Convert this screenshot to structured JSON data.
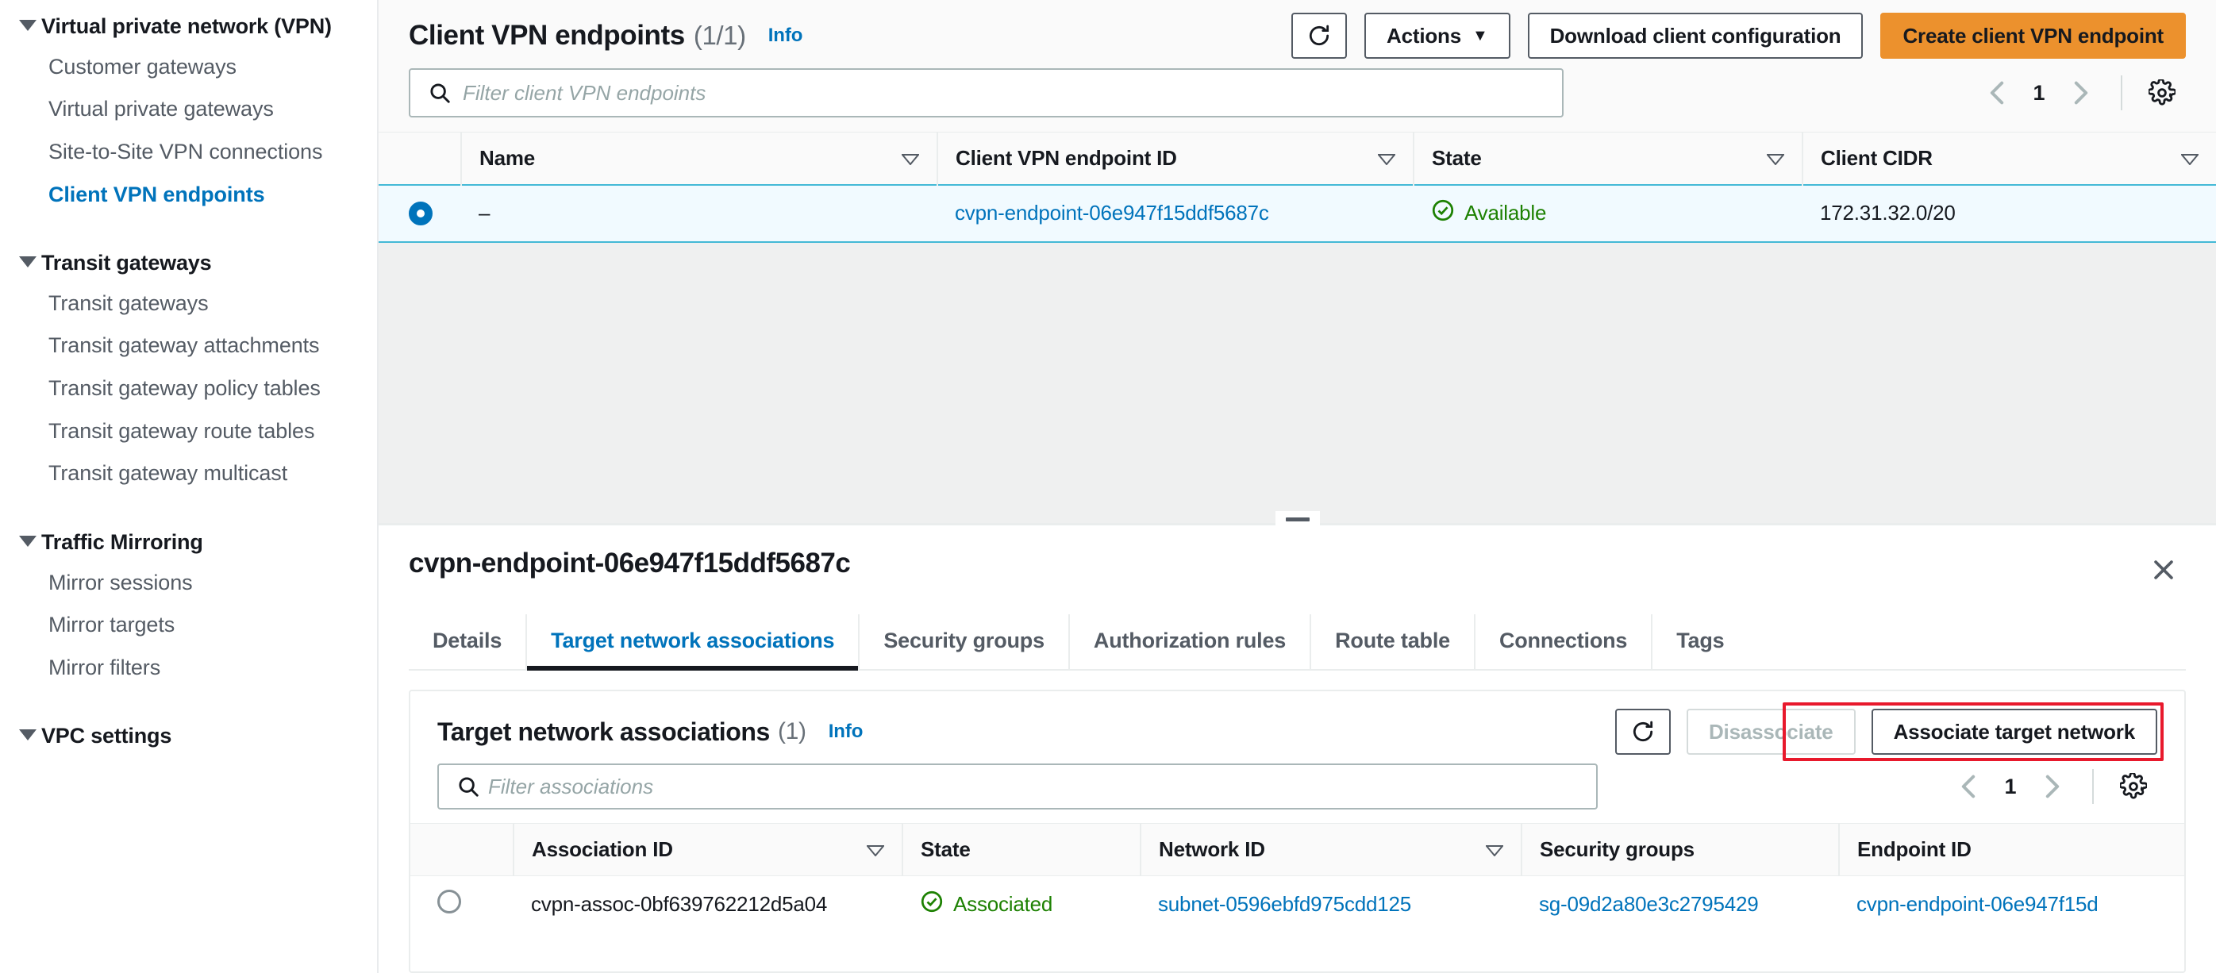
{
  "sidebar": {
    "groups": [
      {
        "title": "Virtual private network (VPN)",
        "icon": "caret-down-icon",
        "items": [
          {
            "label": "Customer gateways",
            "active": false
          },
          {
            "label": "Virtual private gateways",
            "active": false
          },
          {
            "label": "Site-to-Site VPN connections",
            "active": false
          },
          {
            "label": "Client VPN endpoints",
            "active": true
          }
        ]
      },
      {
        "title": "Transit gateways",
        "icon": "caret-down-icon",
        "items": [
          {
            "label": "Transit gateways",
            "active": false
          },
          {
            "label": "Transit gateway attachments",
            "active": false
          },
          {
            "label": "Transit gateway policy tables",
            "active": false
          },
          {
            "label": "Transit gateway route tables",
            "active": false
          },
          {
            "label": "Transit gateway multicast",
            "active": false
          }
        ]
      },
      {
        "title": "Traffic Mirroring",
        "icon": "caret-down-icon",
        "items": [
          {
            "label": "Mirror sessions",
            "active": false
          },
          {
            "label": "Mirror targets",
            "active": false
          },
          {
            "label": "Mirror filters",
            "active": false
          }
        ]
      },
      {
        "title": "VPC settings",
        "icon": "caret-down-icon",
        "items": []
      }
    ]
  },
  "page": {
    "title": "Client VPN endpoints",
    "count": "(1/1)",
    "info_label": "Info",
    "refresh_icon": "refresh-icon",
    "actions_label": "Actions",
    "actions_caret": "chevron-down-icon",
    "download_label": "Download client configuration",
    "create_label": "Create client VPN endpoint",
    "search_placeholder": "Filter client VPN endpoints",
    "search_value": "",
    "search_icon": "search-icon",
    "pagination": {
      "prev_icon": "chevron-left-icon",
      "page": "1",
      "next_icon": "chevron-right-icon",
      "settings_icon": "gear-icon"
    }
  },
  "endpoints_table": {
    "columns": [
      "Name",
      "Client VPN endpoint ID",
      "State",
      "Client CIDR"
    ],
    "sort_icon": "sort-descending-icon",
    "rows": [
      {
        "selected": true,
        "name": "–",
        "endpoint_id": "cvpn-endpoint-06e947f15ddf5687c",
        "state": "Available",
        "state_icon": "status-success-icon",
        "client_cidr": "172.31.32.0/20"
      }
    ]
  },
  "detail": {
    "title": "cvpn-endpoint-06e947f15ddf5687c",
    "close_icon": "close-icon",
    "splitter_icon": "drag-handle-icon",
    "tabs": [
      {
        "label": "Details",
        "active": false
      },
      {
        "label": "Target network associations",
        "active": true,
        "annotated": true
      },
      {
        "label": "Security groups",
        "active": false
      },
      {
        "label": "Authorization rules",
        "active": false
      },
      {
        "label": "Route table",
        "active": false
      },
      {
        "label": "Connections",
        "active": false
      },
      {
        "label": "Tags",
        "active": false
      }
    ]
  },
  "associations_card": {
    "title": "Target network associations",
    "count": "(1)",
    "info_label": "Info",
    "refresh_icon": "refresh-icon",
    "disassociate_label": "Disassociate",
    "associate_label": "Associate target network",
    "associate_annotated": true,
    "search_placeholder": "Filter associations",
    "search_value": "",
    "search_icon": "search-icon",
    "pagination": {
      "prev_icon": "chevron-left-icon",
      "page": "1",
      "next_icon": "chevron-right-icon",
      "settings_icon": "gear-icon"
    },
    "columns": [
      "Association ID",
      "State",
      "Network ID",
      "Security groups",
      "Endpoint ID"
    ],
    "sort_icon": "sort-descending-icon",
    "rows": [
      {
        "selected": false,
        "association_id": "cvpn-assoc-0bf639762212d5a04",
        "state": "Associated",
        "state_icon": "status-success-icon",
        "network_id": "subnet-0596ebfd975cdd125",
        "security_groups": "sg-09d2a80e3c2795429",
        "endpoint_id": "cvpn-endpoint-06e947f15d"
      }
    ]
  },
  "colors": {
    "accent_link": "#0073bb",
    "primary_button": "#ec912d",
    "success": "#1d8102",
    "annotation": "#e8192c",
    "selected_row": "#f1faff",
    "text": "#16191f",
    "muted": "#545b64"
  }
}
